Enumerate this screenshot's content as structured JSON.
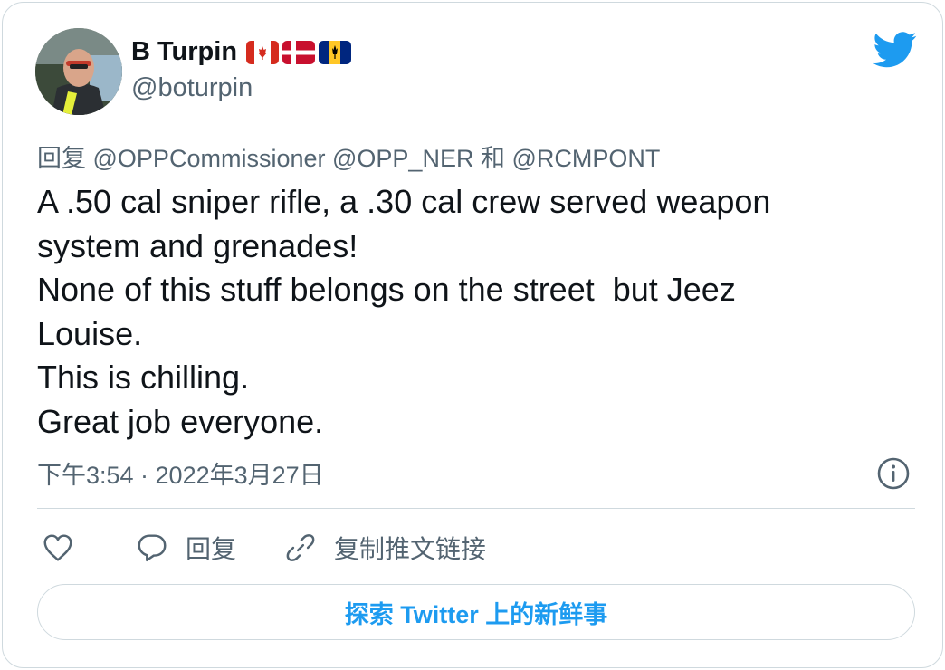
{
  "author": {
    "name": "B Turpin",
    "handle": "@boturpin",
    "flags": [
      "canada-flag-icon",
      "denmark-flag-icon",
      "barbados-flag-icon"
    ]
  },
  "reply_context": {
    "prefix": "回复",
    "handles": [
      "@OPPCommissioner",
      "@OPP_NER"
    ],
    "conjunction": "和",
    "last_handle": "@RCMPONT"
  },
  "tweet": {
    "lines": [
      "A .50 cal sniper rifle, a .30 cal crew served weapon",
      "system and grenades!",
      "None of this stuff belongs on the street  but Jeez",
      "Louise.",
      "This is chilling.",
      "Great job everyone."
    ]
  },
  "meta": {
    "timestamp": "下午3:54 · 2022年3月27日"
  },
  "actions": {
    "reply_label": "回复",
    "copy_link_label": "复制推文链接"
  },
  "explore_button": {
    "label": "探索 Twitter 上的新鲜事"
  },
  "colors": {
    "accent": "#1d9bf0",
    "secondary_text": "#536471",
    "border": "#cfd9de",
    "primary_text": "#0f1419"
  }
}
